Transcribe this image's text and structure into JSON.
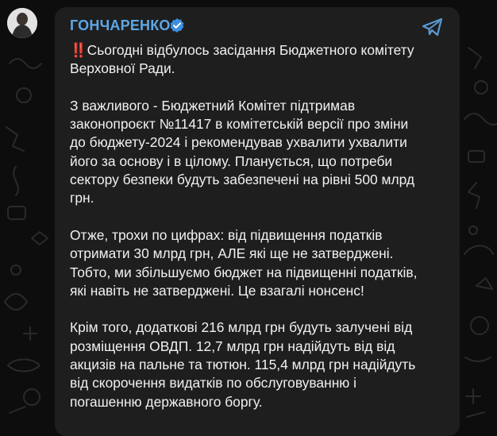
{
  "channel": {
    "name": "ГОНЧАРЕНКО",
    "verified_icon": "verified-check-icon",
    "share_icon": "telegram-share-icon",
    "accent": "#5da7e8"
  },
  "message": {
    "alert_icon": "‼️",
    "paragraphs": [
      {
        "lines": [
          "Сьогодні відбулось засідання Бюджетного комітету",
          "Верховної Ради."
        ]
      },
      {
        "lines": [
          "З важливого - Бюджетний Комітет підтримав",
          "законопроєкт №11417 в комітетській версії про зміни",
          "до бюджету-2024 і рекомендував ухвалити ухвалити",
          "його за основу і в цілому. Планується, що потреби",
          "сектору безпеки будуть забезпечені на рівні 500 млрд",
          "грн."
        ]
      },
      {
        "lines": [
          "Отже, трохи по цифрах: від підвищення податків",
          "отримати 30 млрд грн, АЛЕ які ще не затверджені.",
          "Тобто, ми збільшуємо бюджет на підвищенні податків,",
          "які навіть не затверджені. Це взагалі нонсенс!"
        ]
      },
      {
        "lines": [
          "Крім того, додаткові 216 млрд грн будуть залучені від",
          "розміщення ОВДП. 12,7 млрд грн надійдуть від від",
          "акцизів на пальне та тютюн. 115,4 млрд грн надійдуть",
          "від скорочення видатків по обслуговуванню і",
          "погашенню державного боргу."
        ]
      }
    ]
  }
}
